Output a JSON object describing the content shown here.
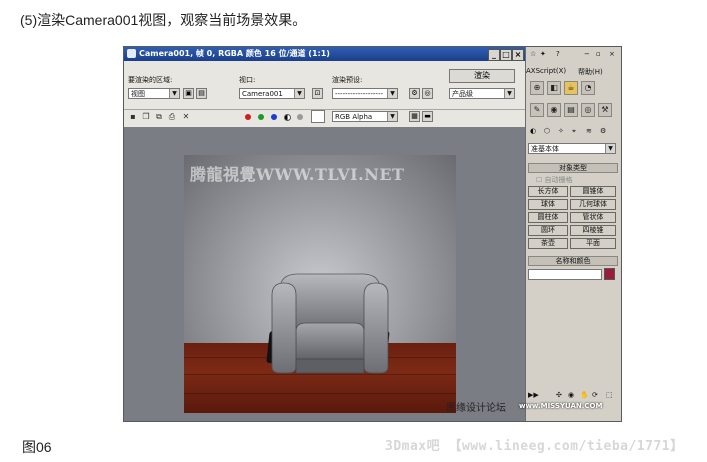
{
  "caption": "(5)渲染Camera001视图，观察当前场景效果。",
  "figure_label": "图06",
  "footer_watermark": "3Dmax吧 【www.lineeg.com/tieba/1771】",
  "render_window": {
    "title": "Camera001, 帧 0, RGBA 颜色 16 位/通道 (1:1)",
    "area_label": "要渲染的区域:",
    "area_value": "视图",
    "viewport_label": "视口:",
    "viewport_value": "Camera001",
    "preset_label": "渲染预设:",
    "preset_value": "-------------------",
    "render_button": "渲染",
    "product_value": "产品级",
    "channel_value": "RGB Alpha",
    "canvas_watermark": "腾龍視覺WWW.TLVI.NET"
  },
  "max_panel": {
    "menu_script": "AXScript(X)",
    "menu_help": "帮助(H)",
    "dropdown": "准基本体",
    "rollout_object_type": "对象类型",
    "autogrid": "自动栅格",
    "objects": [
      "长方体",
      "圆锥体",
      "球体",
      "几何球体",
      "圆柱体",
      "管状体",
      "圆环",
      "四棱锥",
      "茶壶",
      "平面"
    ],
    "rollout_name_color": "名称和颜色",
    "watermark": "思缘设计论坛",
    "watermark2": "www.MISSYUAN.COM"
  },
  "colors": {
    "object_color": "#9b1b3a",
    "title_blue": "#1b3f8a"
  }
}
